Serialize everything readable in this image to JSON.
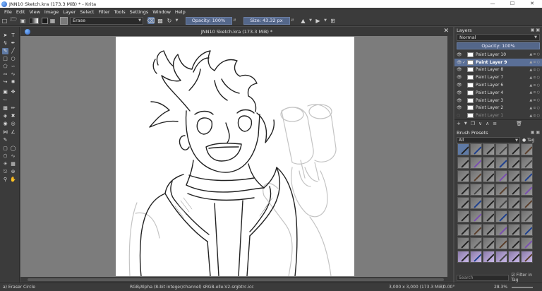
{
  "window": {
    "title": "JNN10 Sketch.kra (173.3 MiB) * - Krita",
    "minimize": "—",
    "maximize": "☐",
    "close": "✕"
  },
  "menu": [
    "File",
    "Edit",
    "View",
    "Image",
    "Layer",
    "Select",
    "Filter",
    "Tools",
    "Settings",
    "Window",
    "Help"
  ],
  "toolbar": {
    "blend_mode": "Erase",
    "opacity": "Opacity: 100%",
    "size": "Size: 43.32 px"
  },
  "document": {
    "tab_title": "JNN10 Sketch.kra (173.3 MiB) *",
    "close": "✕"
  },
  "layers": {
    "title": "Layers",
    "blend_mode": "Normal",
    "opacity": "Opacity: 100%",
    "items": [
      {
        "name": "Paint Layer 10",
        "selected": false
      },
      {
        "name": "Paint Layer 9",
        "selected": true
      },
      {
        "name": "Paint Layer 8",
        "selected": false
      },
      {
        "name": "Paint Layer 7",
        "selected": false
      },
      {
        "name": "Paint Layer 6",
        "selected": false
      },
      {
        "name": "Paint Layer 4",
        "selected": false
      },
      {
        "name": "Paint Layer 3",
        "selected": false
      },
      {
        "name": "Paint Layer 2",
        "selected": false
      },
      {
        "name": "Paint Layer 1",
        "selected": false
      }
    ]
  },
  "brush_presets": {
    "title": "Brush Presets",
    "filter": "All",
    "tag": "Tag",
    "search_placeholder": "Search",
    "filter_in_tag": "Filter in Tag"
  },
  "status": {
    "tool": "a) Eraser Circle",
    "color_info": "RGB/Alpha (8-bit integer/channel)  sRGB-elle-V2-srgbtrc.icc",
    "image_size": "3,000 x 3,000 (173.3 MiB)",
    "rotation": "0.00°",
    "zoom": "28.3%"
  },
  "colors": {
    "accent": "#5a6f97",
    "panel": "#3b3b3b",
    "canvas_bg": "#7c7c7c"
  }
}
